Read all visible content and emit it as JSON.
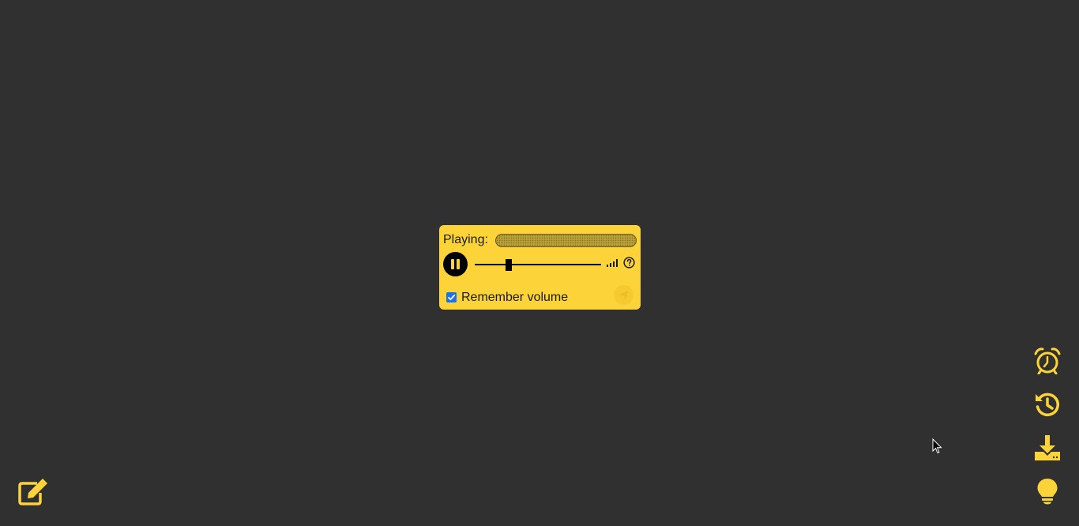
{
  "player": {
    "playing_label": "Playing:",
    "track_name": "",
    "volume": 0.27,
    "remember_volume_label": "Remember volume",
    "remember_volume_checked": true,
    "pause_icon": "pause-icon",
    "volume_icon": "volume-bars-icon",
    "help_icon": "question-circle-icon",
    "send_icon": "paper-plane-icon"
  },
  "side_actions": [
    {
      "icon": "alarm-clock-icon"
    },
    {
      "icon": "history-icon"
    },
    {
      "icon": "download-icon"
    },
    {
      "icon": "lightbulb-icon"
    }
  ],
  "bottom_left_action": {
    "icon": "edit-icon"
  },
  "colors": {
    "background": "#303030",
    "accent": "#fdd33a",
    "checkbox": "#1a73e8"
  }
}
